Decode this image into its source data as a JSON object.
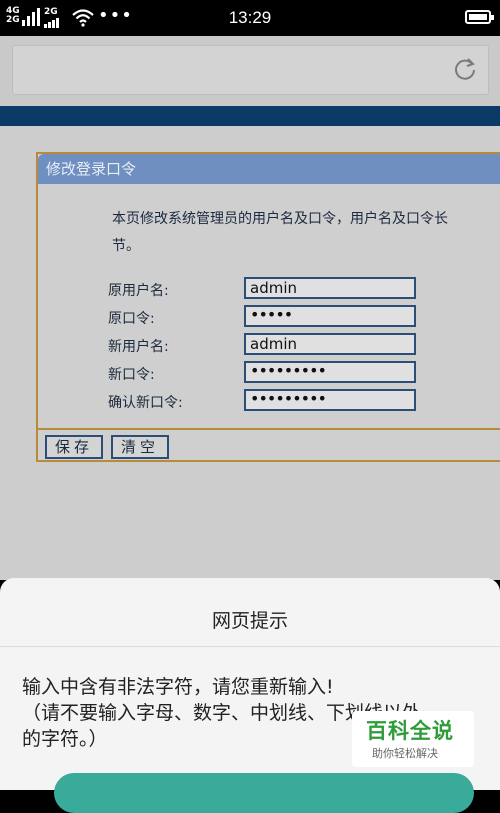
{
  "status": {
    "time": "13:29",
    "net1": "4G",
    "net2": "2G",
    "more": "•••"
  },
  "browser": {
    "reload_icon": "reload-icon"
  },
  "panel": {
    "title": "修改登录口令",
    "intro_line1": "本页修改系统管理员的用户名及口令，用户名及口令长",
    "intro_line2": "节。",
    "fields": [
      {
        "label": "原用户名:",
        "value": "admin"
      },
      {
        "label": "原口令:",
        "value": "•••••"
      },
      {
        "label": "新用户名:",
        "value": "admin"
      },
      {
        "label": "新口令:",
        "value": "•••••••••"
      },
      {
        "label": "确认新口令:",
        "value": "•••••••••"
      }
    ],
    "save_label": "保存",
    "clear_label": "清空"
  },
  "dialog": {
    "title": "网页提示",
    "message_line1": "输入中含有非法字符，请您重新输入!",
    "message_line2": "（请不要输入字母、数字、中划线、下划线以外",
    "message_line3": "的字符。）"
  },
  "watermark": {
    "brand": "百科全说",
    "slogan": "助你轻松解决"
  }
}
